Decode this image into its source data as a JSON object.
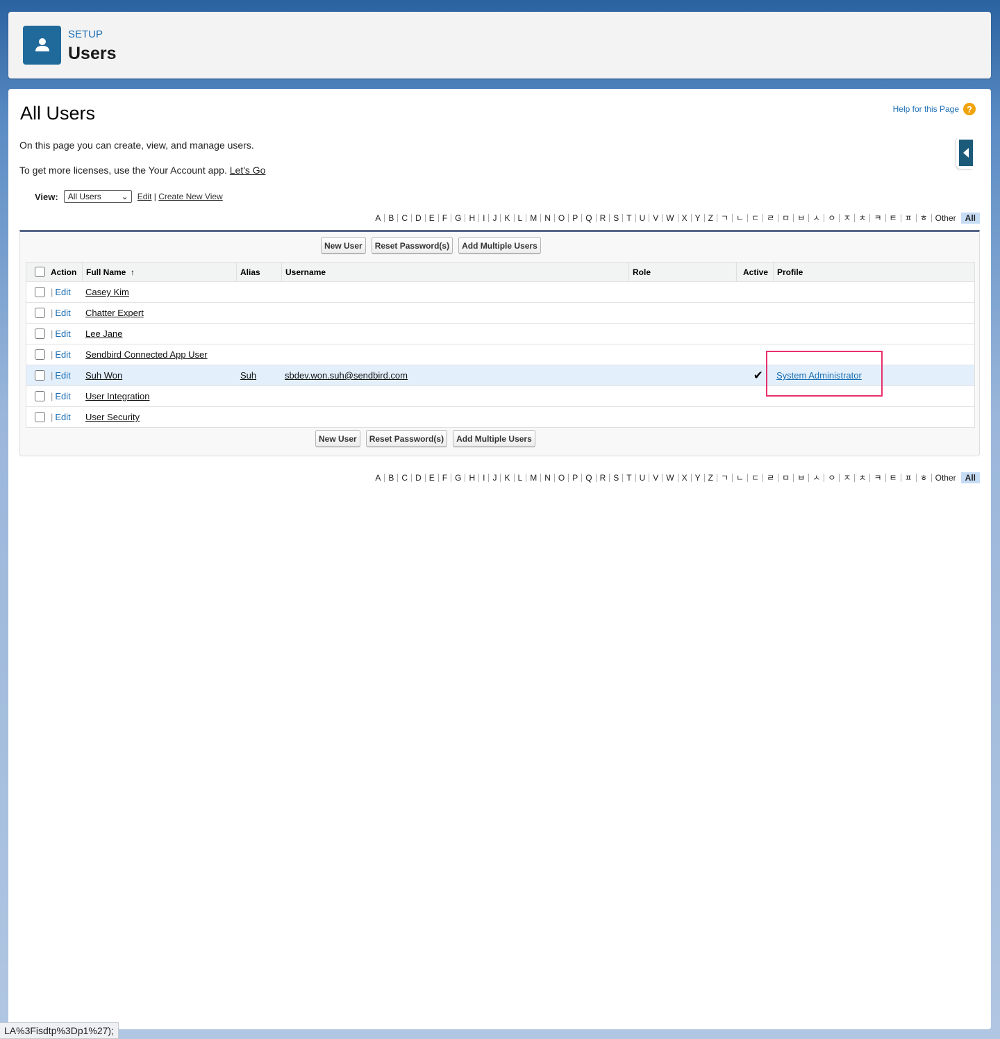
{
  "header": {
    "eyebrow": "SETUP",
    "title": "Users",
    "icon": "user-icon"
  },
  "page": {
    "title": "All Users",
    "help": "Help for this Page",
    "desc": "On this page you can create, view, and manage users.",
    "license_text": "To get more licenses, use the Your Account app.",
    "license_link": "Let's Go"
  },
  "view": {
    "label": "View:",
    "selected": "All Users",
    "edit": "Edit",
    "sep": "|",
    "create": "Create New View"
  },
  "alphabet": [
    "A",
    "B",
    "C",
    "D",
    "E",
    "F",
    "G",
    "H",
    "I",
    "J",
    "K",
    "L",
    "M",
    "N",
    "O",
    "P",
    "Q",
    "R",
    "S",
    "T",
    "U",
    "V",
    "W",
    "X",
    "Y",
    "Z",
    "ㄱ",
    "ㄴ",
    "ㄷ",
    "ㄹ",
    "ㅁ",
    "ㅂ",
    "ㅅ",
    "ㅇ",
    "ㅈ",
    "ㅊ",
    "ㅋ",
    "ㅌ",
    "ㅍ",
    "ㅎ",
    "Other"
  ],
  "alphabet_selected": "All",
  "buttons": {
    "new_user": "New User",
    "reset": "Reset Password(s)",
    "add_multiple": "Add Multiple Users"
  },
  "table": {
    "columns": {
      "action": "Action",
      "full_name": "Full Name",
      "sort": "↑",
      "alias": "Alias",
      "username": "Username",
      "role": "Role",
      "active": "Active",
      "profile": "Profile"
    },
    "edit_label": "Edit",
    "rows": [
      {
        "name": "Casey Kim",
        "alias": "",
        "username": "",
        "role": "",
        "active": "",
        "profile": ""
      },
      {
        "name": "Chatter Expert",
        "alias": "",
        "username": "",
        "role": "",
        "active": "",
        "profile": ""
      },
      {
        "name": "Lee Jane",
        "alias": "",
        "username": "",
        "role": "",
        "active": "",
        "profile": ""
      },
      {
        "name": "Sendbird Connected App User",
        "alias": "",
        "username": "",
        "role": "",
        "active": "",
        "profile": ""
      },
      {
        "name": "Suh Won",
        "alias": "Suh",
        "username": "sbdev.won.suh@sendbird.com",
        "role": "",
        "active": "✔",
        "profile": "System Administrator",
        "highlighted": true
      },
      {
        "name": "User Integration",
        "alias": "",
        "username": "",
        "role": "",
        "active": "",
        "profile": ""
      },
      {
        "name": "User Security",
        "alias": "",
        "username": "",
        "role": "",
        "active": "",
        "profile": ""
      }
    ]
  },
  "colors": {
    "accent": "#1b6eb3",
    "highlight_box": "#e8306a",
    "row_highlight": "#e3f0fc"
  },
  "status_bar": "LA%3Fisdtp%3Dp1%27);"
}
